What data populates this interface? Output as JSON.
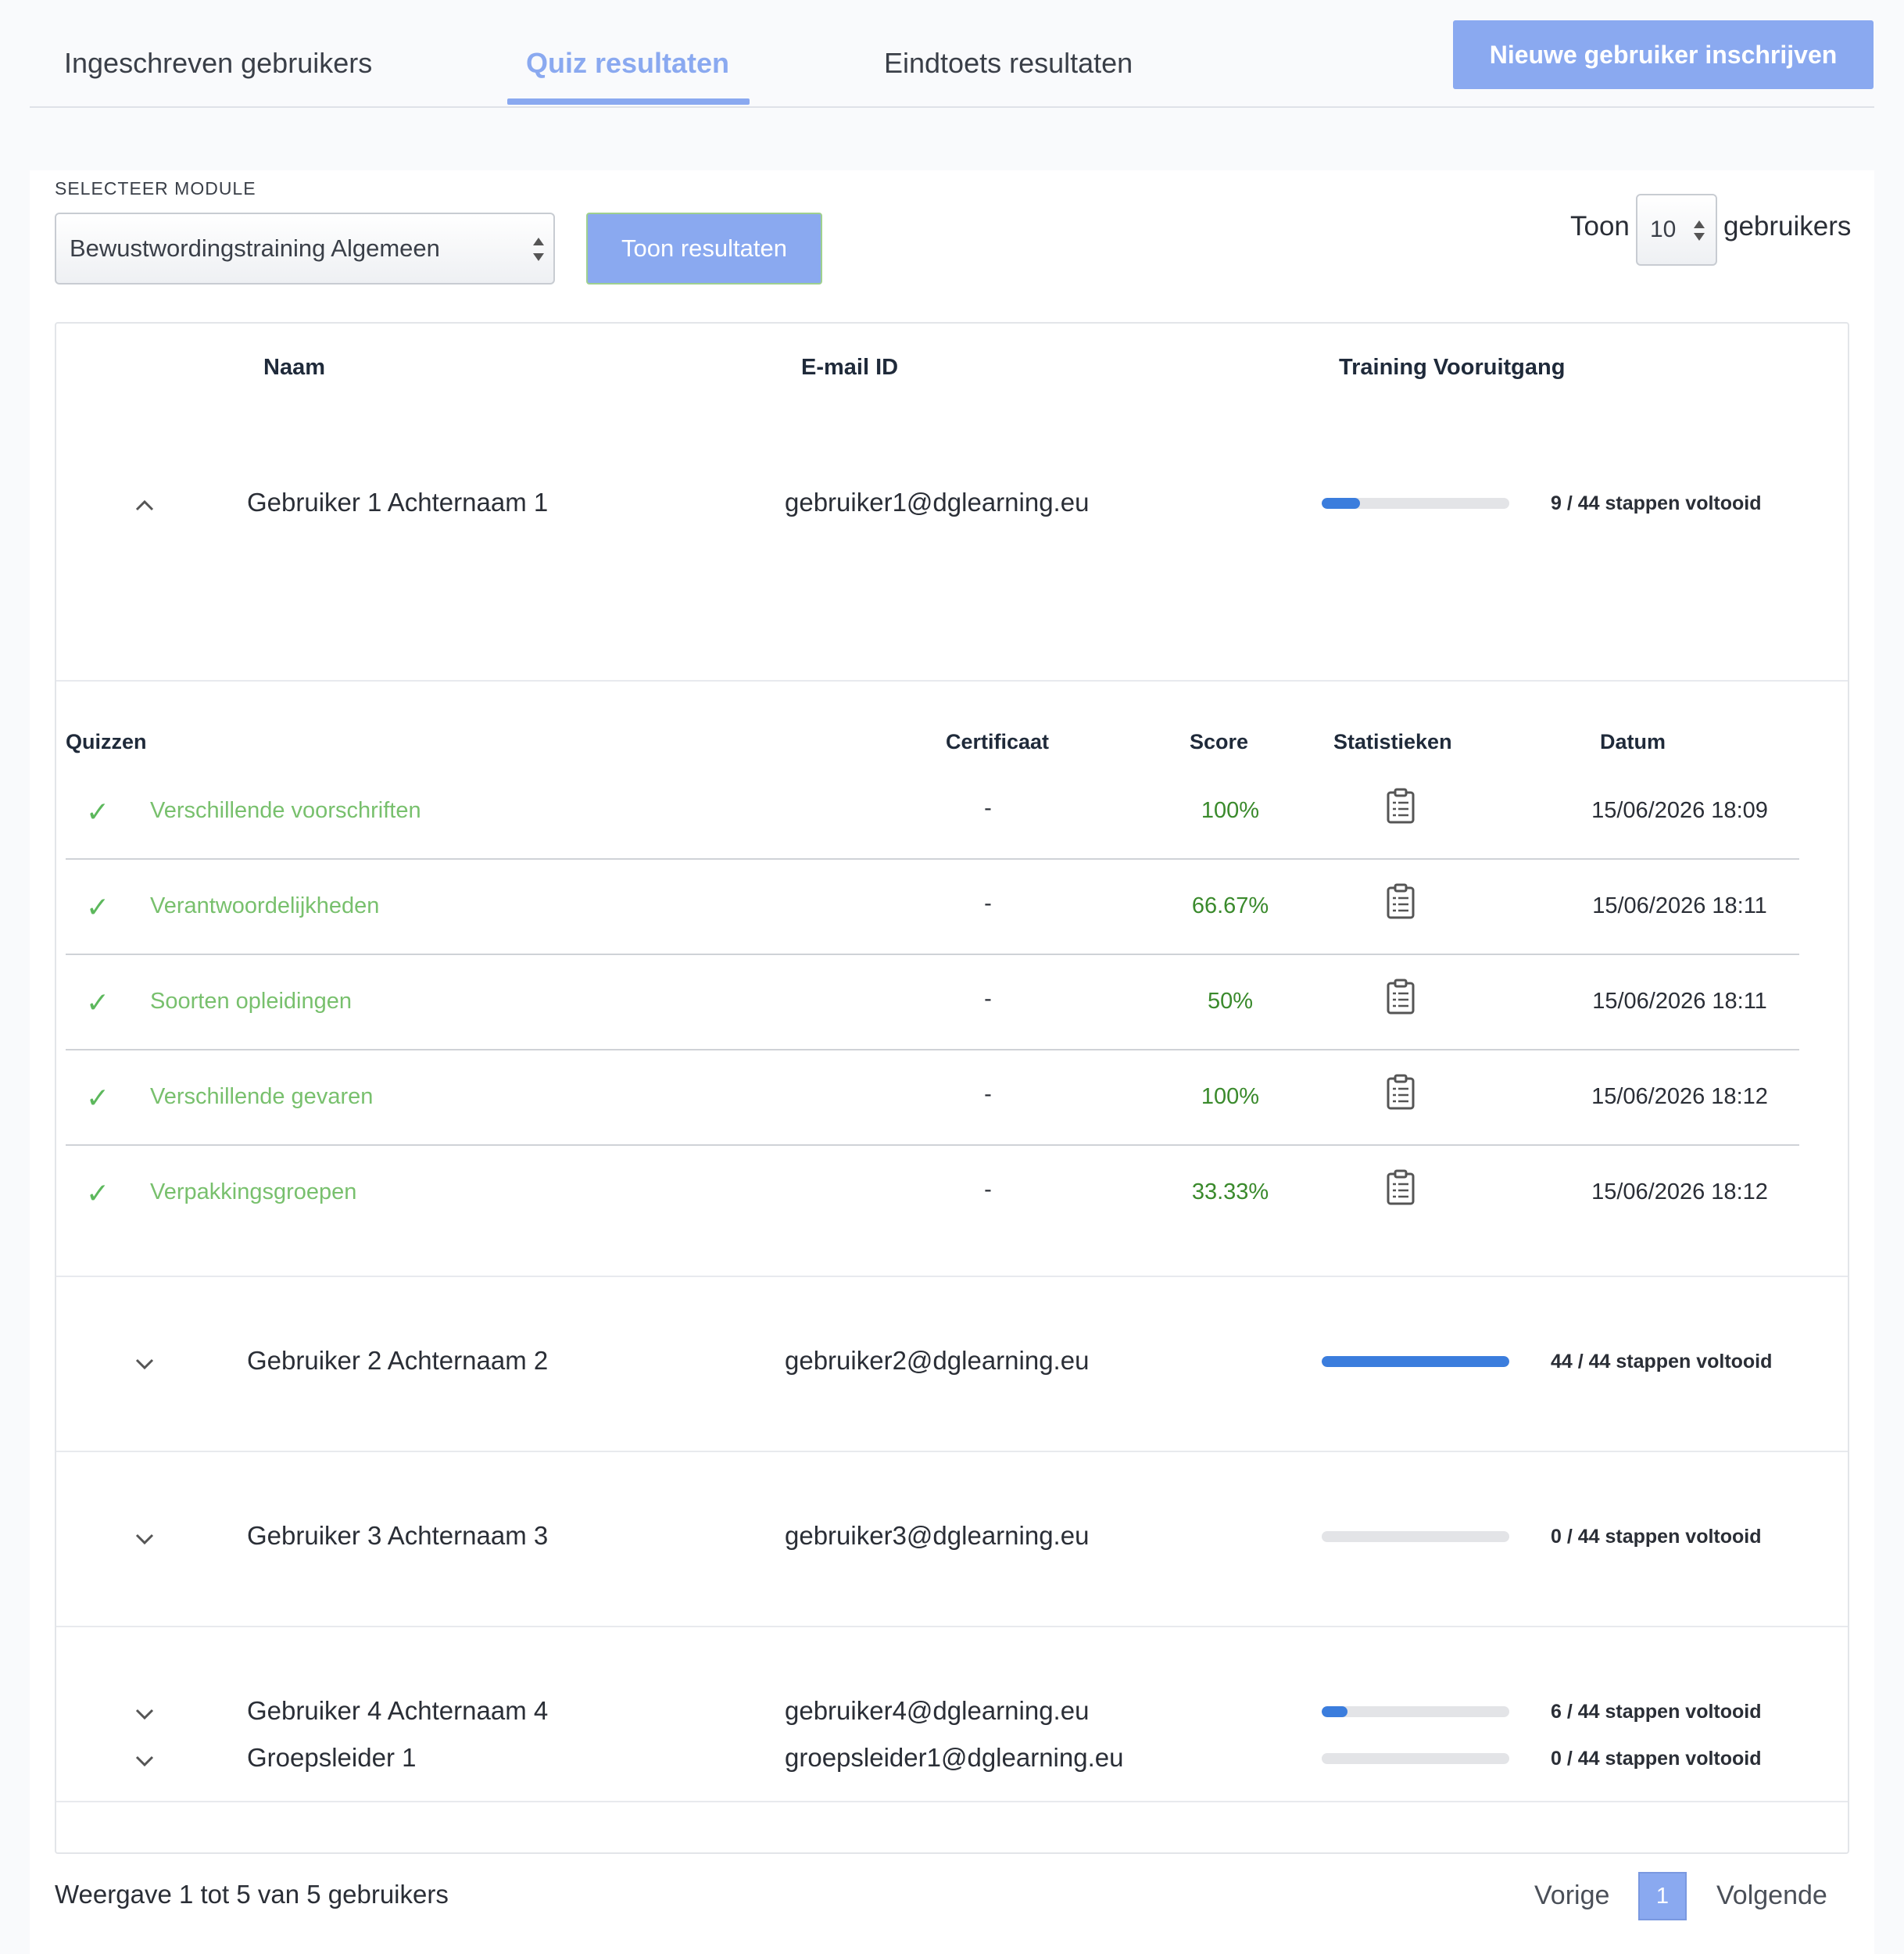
{
  "tabs": {
    "enrolled": "Ingeschreven gebruikers",
    "quiz": "Quiz resultaten",
    "final": "Eindtoets resultaten"
  },
  "new_user_button": "Nieuwe gebruiker inschrijven",
  "filters": {
    "module_label": "SELECTEER MODULE",
    "module_selected": "Bewustwordingstraining Algemeen",
    "show_button": "Toon resultaten",
    "show_prefix": "Toon",
    "page_size": "10",
    "show_suffix": "gebruikers"
  },
  "table": {
    "headers": {
      "name": "Naam",
      "email": "E-mail ID",
      "progress": "Training Vooruitgang"
    },
    "users": [
      {
        "name": "Gebruiker 1 Achternaam 1",
        "email": "gebruiker1@dglearning.eu",
        "progress_text": "9 / 44 stappen voltooid",
        "progress": 0.2045,
        "expanded": true
      },
      {
        "name": "Gebruiker 2 Achternaam 2",
        "email": "gebruiker2@dglearning.eu",
        "progress_text": "44 / 44 stappen voltooid",
        "progress": 1.0,
        "expanded": false
      },
      {
        "name": "Gebruiker 3 Achternaam 3",
        "email": "gebruiker3@dglearning.eu",
        "progress_text": "0 / 44 stappen voltooid",
        "progress": 0.0,
        "expanded": false
      },
      {
        "name": "Gebruiker 4 Achternaam 4",
        "email": "gebruiker4@dglearning.eu",
        "progress_text": "6 / 44 stappen voltooid",
        "progress": 0.1364,
        "expanded": false
      },
      {
        "name": "Groepsleider 1",
        "email": "groepsleider1@dglearning.eu",
        "progress_text": "0 / 44 stappen voltooid",
        "progress": 0.0,
        "expanded": false
      }
    ]
  },
  "quiz_table": {
    "headers": {
      "quizzes": "Quizzen",
      "certificate": "Certificaat",
      "score": "Score",
      "stats": "Statistieken",
      "date": "Datum"
    },
    "rows": [
      {
        "name": "Verschillende voorschriften",
        "certificate": "-",
        "score": "100%",
        "date": "15/06/2026 18:09"
      },
      {
        "name": "Verantwoordelijkheden",
        "certificate": "-",
        "score": "66.67%",
        "date": "15/06/2026 18:11"
      },
      {
        "name": "Soorten opleidingen",
        "certificate": "-",
        "score": "50%",
        "date": "15/06/2026 18:11"
      },
      {
        "name": "Verschillende gevaren",
        "certificate": "-",
        "score": "100%",
        "date": "15/06/2026 18:12"
      },
      {
        "name": "Verpakkingsgroepen",
        "certificate": "-",
        "score": "33.33%",
        "date": "15/06/2026 18:12"
      }
    ]
  },
  "footer": {
    "summary": "Weergave 1 tot 5 van 5 gebruikers",
    "prev": "Vorige",
    "current_page": "1",
    "next": "Volgende"
  },
  "colors": {
    "accent": "#8aa9f0",
    "progress": "#3b7ddd",
    "quiz_link": "#78c06d",
    "score": "#3a8a2c"
  },
  "icons": {
    "chevron_up": "chevron-up-icon",
    "chevron_down": "chevron-down-icon",
    "check": "check-icon",
    "stats": "clipboard-icon"
  }
}
